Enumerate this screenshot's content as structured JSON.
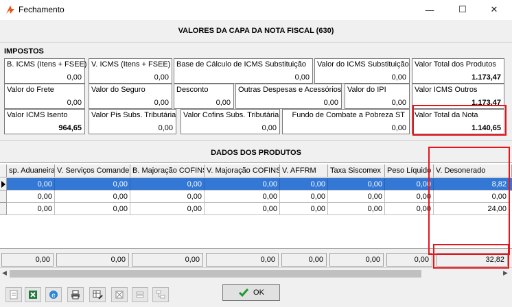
{
  "window": {
    "title": "Fechamento",
    "minimize": "—",
    "maximize": "☐",
    "close": "✕"
  },
  "header": {
    "title": "VALORES DA CAPA DA NOTA FISCAL (630)"
  },
  "impostos": {
    "label": "IMPOSTOS",
    "row1": [
      {
        "label": "B. ICMS (Itens + FSEE)",
        "value": "0,00"
      },
      {
        "label": "V. ICMS (Itens + FSEE)",
        "value": "0,00"
      },
      {
        "label": "Base de Cálculo de ICMS Substituição",
        "value": "0,00"
      },
      {
        "label": "Valor do ICMS Substituição",
        "value": "0,00"
      },
      {
        "label": "Valor Total dos Produtos",
        "value": "1.173,47"
      }
    ],
    "row2": [
      {
        "label": "Valor do Frete",
        "value": "0,00"
      },
      {
        "label": "Valor do Seguro",
        "value": "0,00"
      },
      {
        "label": "Desconto",
        "value": "0,00"
      },
      {
        "label": "Outras Despesas e Acessórios",
        "value": "0,00"
      },
      {
        "label": "Valor do IPI",
        "value": "0,00"
      },
      {
        "label": "Valor ICMS Outros",
        "value": "1.173,47"
      }
    ],
    "row3": [
      {
        "label": "Valor ICMS Isento",
        "value": "964,65"
      },
      {
        "label": "Valor Pis Subs. Tributária",
        "value": "0,00"
      },
      {
        "label": "Valor Cofins Subs. Tributária",
        "value": "0,00"
      },
      {
        "label": "Fundo de Combate a Pobreza ST",
        "value": "0,00"
      },
      {
        "label": "Valor Total da Nota",
        "value": "1.140,65"
      }
    ]
  },
  "produtos": {
    "label": "DADOS DOS PRODUTOS",
    "columns": [
      "sp. Aduaneira",
      "V. Serviços Comander",
      "B. Majoração COFINS",
      "V. Majoração COFINS",
      "V. AFFRM",
      "Taxa Siscomex",
      "Peso Líquido",
      "V. Desonerado"
    ],
    "rows": [
      [
        "0,00",
        "0,00",
        "0,00",
        "0,00",
        "0,00",
        "0,00",
        "0,00",
        "8,82"
      ],
      [
        "0,00",
        "0,00",
        "0,00",
        "0,00",
        "0,00",
        "0,00",
        "0,00",
        "0,00"
      ],
      [
        "0,00",
        "0,00",
        "0,00",
        "0,00",
        "0,00",
        "0,00",
        "0,00",
        "24,00"
      ]
    ],
    "totals": [
      "0,00",
      "0,00",
      "0,00",
      "0,00",
      "0,00",
      "0,00",
      "0,00",
      "32,82"
    ]
  },
  "footer": {
    "ok_label": "OK"
  },
  "colors": {
    "highlight": "#e8141c",
    "selection": "#3378d4"
  }
}
